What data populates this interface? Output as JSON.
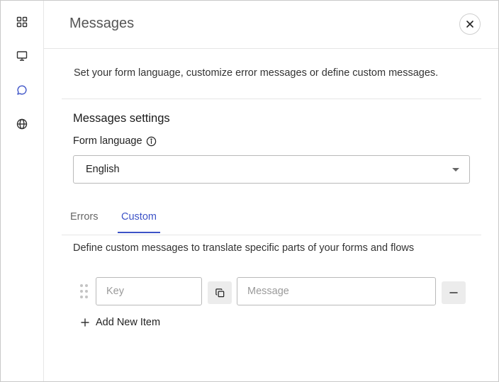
{
  "rail": {
    "items": [
      {
        "name": "grid-icon"
      },
      {
        "name": "monitor-icon"
      },
      {
        "name": "chat-icon",
        "active": true
      },
      {
        "name": "globe-icon"
      }
    ]
  },
  "header": {
    "title": "Messages",
    "close_icon": "close-icon"
  },
  "intro": {
    "description": "Set your form language, customize error messages or define custom messages."
  },
  "settings": {
    "title": "Messages settings",
    "language_label": "Form language",
    "language_value": "English"
  },
  "tabs": [
    {
      "label": "Errors",
      "active": false
    },
    {
      "label": "Custom",
      "active": true
    }
  ],
  "custom": {
    "description": "Define custom messages to translate specific parts of your forms and flows",
    "rows": [
      {
        "key_placeholder": "Key",
        "message_placeholder": "Message"
      }
    ],
    "add_label": "Add New Item"
  },
  "colors": {
    "accent": "#3d53c7",
    "border": "#b9b9b9",
    "button_bg": "#ececec"
  }
}
